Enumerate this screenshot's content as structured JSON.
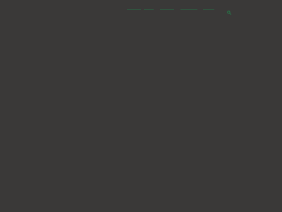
{
  "site": {
    "logo_text": "",
    "accent_color": "#1f8a4c",
    "background_color": "#3a3938"
  },
  "nav": {
    "items": [
      {
        "label": ""
      },
      {
        "label": ""
      },
      {
        "label": ""
      },
      {
        "label": ""
      },
      {
        "label": ""
      }
    ]
  },
  "search": {
    "icon": "search-icon"
  }
}
